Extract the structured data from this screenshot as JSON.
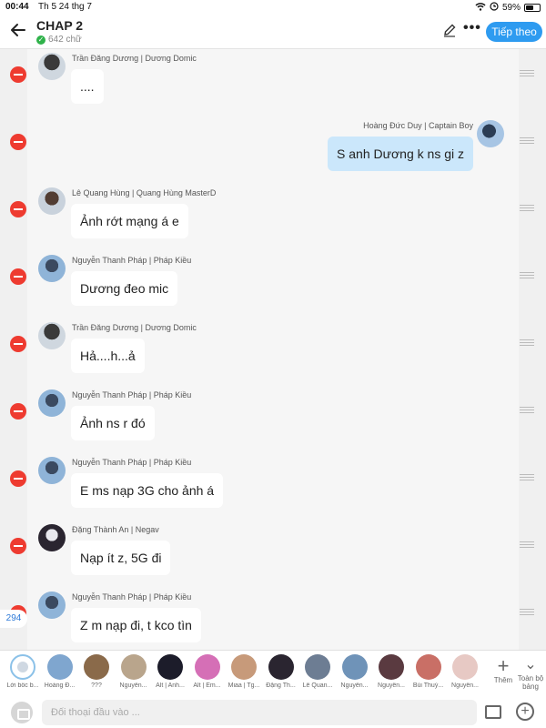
{
  "status": {
    "time": "00:44",
    "date": "Th 5 24 thg 7",
    "battery": "59%",
    "battery_level": 0.59
  },
  "header": {
    "title": "CHAP 2",
    "word_count": "642 chữ",
    "follow_label": "Tiếp theo"
  },
  "messages": [
    {
      "name": "Trần Đăng Dương | Dương Domic",
      "text": "....",
      "side": "left",
      "avatar": "av1"
    },
    {
      "name": "Hoàng Đức Duy | Captain Boy",
      "text": "S anh Dương k ns gi z",
      "side": "right",
      "avatar": "av2"
    },
    {
      "name": "Lê Quang Hùng | Quang Hùng MasterD",
      "text": "Ảnh rớt mạng á e",
      "side": "left",
      "avatar": "av3"
    },
    {
      "name": "Nguyễn Thanh Pháp | Pháp Kiều",
      "text": "Dương đeo mic",
      "side": "left",
      "avatar": "av4"
    },
    {
      "name": "Trần Đăng Dương | Dương Domic",
      "text": "Hả....h...ả",
      "side": "left",
      "avatar": "av1"
    },
    {
      "name": "Nguyễn Thanh Pháp | Pháp Kiều",
      "text": "Ảnh ns r đó",
      "side": "left",
      "avatar": "av4"
    },
    {
      "name": "Nguyễn Thanh Pháp | Pháp Kiều",
      "text": "E ms nạp 3G cho ảnh á",
      "side": "left",
      "avatar": "av4"
    },
    {
      "name": "Đặng Thành An | Negav",
      "text": "Nạp ít z, 5G đi",
      "side": "left",
      "avatar": "av5"
    },
    {
      "name": "Nguyễn Thanh Pháp | Pháp Kiều",
      "text": "Z m nạp đi, t kco tìn",
      "side": "left",
      "avatar": "av4"
    }
  ],
  "count_badge": "294",
  "characters": [
    {
      "label": "Lời bốc b...",
      "color": "#ffffff"
    },
    {
      "label": "Hoàng Đ...",
      "color": "#7fa6cf"
    },
    {
      "label": "???",
      "color": "#8a6a4a"
    },
    {
      "label": "Nguyễn...",
      "color": "#b9a58c"
    },
    {
      "label": "Alt | Anh...",
      "color": "#1c1c2a"
    },
    {
      "label": "Alt | Em...",
      "color": "#d56fb6"
    },
    {
      "label": "Miaa | Tg...",
      "color": "#c79a7a"
    },
    {
      "label": "Đặng Th...",
      "color": "#2a2530"
    },
    {
      "label": "Lê Quan...",
      "color": "#6d7d93"
    },
    {
      "label": "Nguyễn...",
      "color": "#6f93b8"
    },
    {
      "label": "Nguyễn...",
      "color": "#5a3a40"
    },
    {
      "label": "Bùi Thuỳ...",
      "color": "#c96f66"
    },
    {
      "label": "Nguyễn...",
      "color": "#e7c9c4"
    }
  ],
  "add_label": "Thêm",
  "all_label": "Toàn bộ bảng",
  "input_placeholder": "Đối thoại đầu vào ..."
}
